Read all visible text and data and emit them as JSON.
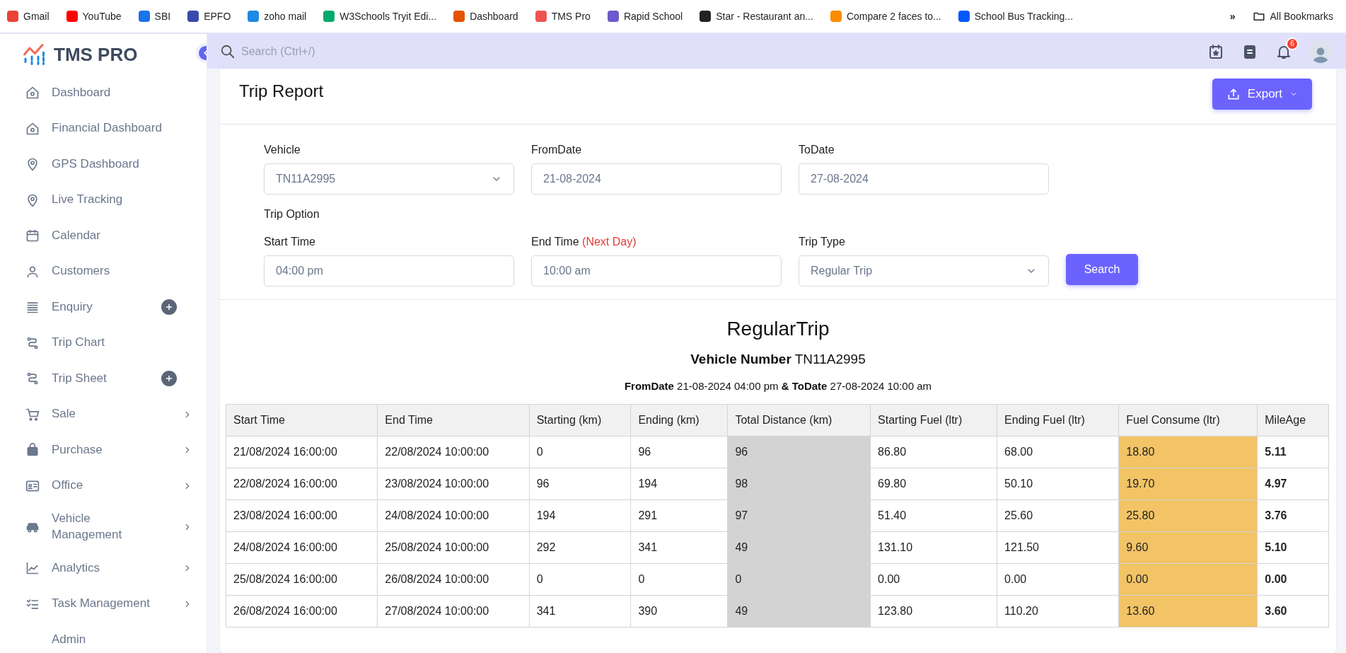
{
  "bookmarks": [
    {
      "label": "Gmail"
    },
    {
      "label": "YouTube"
    },
    {
      "label": "SBI"
    },
    {
      "label": "EPFO"
    },
    {
      "label": "zoho mail"
    },
    {
      "label": "W3Schools Tryit Edi..."
    },
    {
      "label": "Dashboard"
    },
    {
      "label": "TMS Pro"
    },
    {
      "label": "Rapid School"
    },
    {
      "label": "Star - Restaurant an..."
    },
    {
      "label": "Compare 2 faces to..."
    },
    {
      "label": "School Bus Tracking..."
    }
  ],
  "bookmarks_overflow": "»",
  "all_bookmarks": "All Bookmarks",
  "sidebar": {
    "brand": "TMS PRO",
    "items": [
      {
        "label": "Dashboard",
        "add_button": false,
        "submenu": false
      },
      {
        "label": "Financial Dashboard",
        "add_button": false,
        "submenu": false
      },
      {
        "label": "GPS Dashboard",
        "add_button": false,
        "submenu": false
      },
      {
        "label": "Live Tracking",
        "add_button": false,
        "submenu": false
      },
      {
        "label": "Calendar",
        "add_button": false,
        "submenu": false
      },
      {
        "label": "Customers",
        "add_button": false,
        "submenu": false
      },
      {
        "label": "Enquiry",
        "add_button": true,
        "submenu": false
      },
      {
        "label": "Trip Chart",
        "add_button": false,
        "submenu": false
      },
      {
        "label": "Trip Sheet",
        "add_button": true,
        "submenu": false
      },
      {
        "label": "Sale",
        "add_button": false,
        "submenu": true
      },
      {
        "label": "Purchase",
        "add_button": false,
        "submenu": true
      },
      {
        "label": "Office",
        "add_button": false,
        "submenu": true
      },
      {
        "label": "Vehicle Management",
        "add_button": false,
        "submenu": true
      },
      {
        "label": "Analytics",
        "add_button": false,
        "submenu": true
      },
      {
        "label": "Task Management",
        "add_button": false,
        "submenu": true
      },
      {
        "label": "Admin",
        "add_button": false,
        "submenu": false
      }
    ]
  },
  "header": {
    "search_placeholder": "Search (Ctrl+/)",
    "notification_count": "6"
  },
  "report": {
    "title": "Trip Report",
    "export_label": "Export",
    "filters": [
      {
        "label": "Vehicle",
        "value": "TN11A2995",
        "kind": "select"
      },
      {
        "label": "FromDate",
        "value": "21-08-2024",
        "kind": "input"
      },
      {
        "label": "ToDate",
        "value": "27-08-2024",
        "kind": "input"
      }
    ],
    "trip_option_label": "Trip Option",
    "options": [
      {
        "label": "Start Time",
        "value": "04:00 pm",
        "kind": "input"
      },
      {
        "label": "End Time",
        "note": "(Next Day)",
        "value": "10:00 am",
        "kind": "input"
      },
      {
        "label": "Trip Type",
        "value": "Regular Trip",
        "kind": "select"
      }
    ],
    "search_label": "Search",
    "result_title": "RegularTrip",
    "vehicle_line": "**Vehicle Number** TN11A2995",
    "date_line": "**FromDate** 21-08-2024 04:00 pm **& ToDate** 27-08-2024 10:00 am",
    "table": {
      "columns": [
        {
          "label": "Start Time",
          "kind": "plain"
        },
        {
          "label": "End Time",
          "kind": "plain"
        },
        {
          "label": "Starting (km)",
          "kind": "plain"
        },
        {
          "label": "Ending (km)",
          "kind": "plain"
        },
        {
          "label": "Total Distance (km)",
          "kind": "shaded"
        },
        {
          "label": "Starting Fuel (ltr)",
          "kind": "plain"
        },
        {
          "label": "Ending Fuel (ltr)",
          "kind": "plain"
        },
        {
          "label": "Fuel Consume (ltr)",
          "kind": "highlight"
        },
        {
          "label": "MileAge",
          "kind": "bold"
        }
      ],
      "rows": [
        [
          "21/08/2024 16:00:00",
          "22/08/2024 10:00:00",
          "0",
          "96",
          "96",
          "86.80",
          "68.00",
          "18.80",
          "5.11"
        ],
        [
          "22/08/2024 16:00:00",
          "23/08/2024 10:00:00",
          "96",
          "194",
          "98",
          "69.80",
          "50.10",
          "19.70",
          "4.97"
        ],
        [
          "23/08/2024 16:00:00",
          "24/08/2024 10:00:00",
          "194",
          "291",
          "97",
          "51.40",
          "25.60",
          "25.80",
          "3.76"
        ],
        [
          "24/08/2024 16:00:00",
          "25/08/2024 10:00:00",
          "292",
          "341",
          "49",
          "131.10",
          "121.50",
          "9.60",
          "5.10"
        ],
        [
          "25/08/2024 16:00:00",
          "26/08/2024 10:00:00",
          "0",
          "0",
          "0",
          "0.00",
          "0.00",
          "0.00",
          "0.00"
        ],
        [
          "26/08/2024 16:00:00",
          "27/08/2024 10:00:00",
          "341",
          "390",
          "49",
          "123.80",
          "110.20",
          "13.60",
          "3.60"
        ]
      ]
    }
  }
}
